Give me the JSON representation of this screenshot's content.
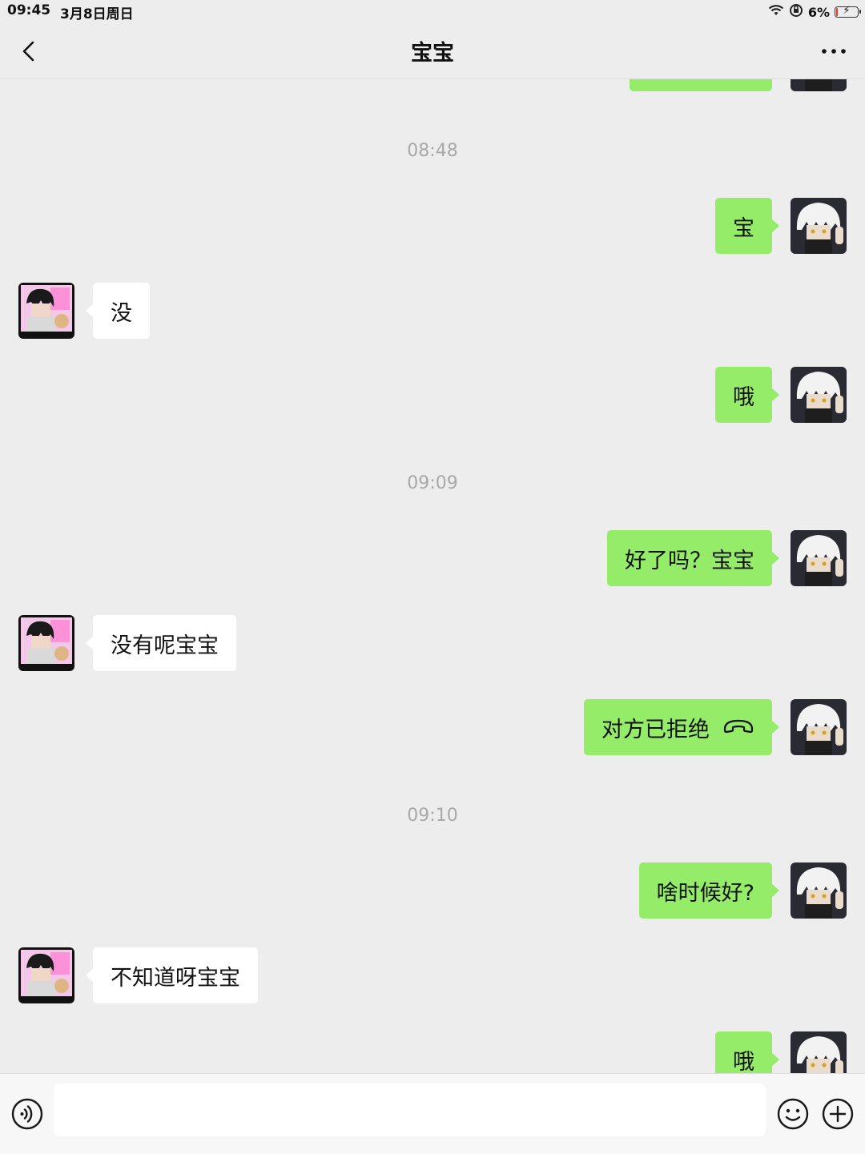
{
  "status_bar": {
    "time": "09:45",
    "date": "3月8日周日",
    "battery": "6%",
    "battery_level": 0.06
  },
  "nav": {
    "title": "宝宝",
    "back_icon": "chevron-left-icon",
    "more_icon": "more-icon"
  },
  "messages": [
    {
      "type": "time",
      "text": "08:48"
    },
    {
      "type": "sent",
      "text": "宝"
    },
    {
      "type": "received",
      "text": "没"
    },
    {
      "type": "sent",
      "text": "哦"
    },
    {
      "type": "time",
      "text": "09:09"
    },
    {
      "type": "sent",
      "text": "好了吗？宝宝"
    },
    {
      "type": "received",
      "text": "没有呢宝宝"
    },
    {
      "type": "sent",
      "text": "对方已拒绝",
      "icon": "hangup-icon"
    },
    {
      "type": "time",
      "text": "09:10"
    },
    {
      "type": "sent",
      "text": "啥时候好?"
    },
    {
      "type": "received",
      "text": "不知道呀宝宝"
    },
    {
      "type": "sent",
      "text": "哦"
    }
  ],
  "input_bar": {
    "value": "",
    "voice_icon": "voice-icon",
    "emoji_icon": "emoji-icon",
    "plus_icon": "plus-icon"
  },
  "colors": {
    "sent_bubble": "#95ec69",
    "received_bubble": "#ffffff",
    "background": "#ededed"
  }
}
